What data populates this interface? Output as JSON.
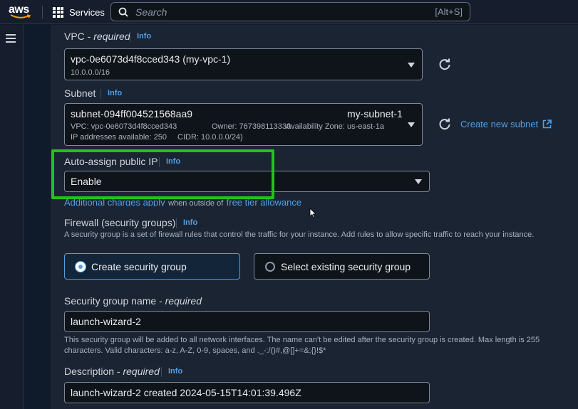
{
  "topbar": {
    "logo": "aws",
    "services_label": "Services",
    "search_placeholder": "Search",
    "search_shortcut": "[Alt+S]"
  },
  "vpc": {
    "label": "VPC",
    "required": "required",
    "info": "Info",
    "value": "vpc-0e6073d4f8cced343 (my-vpc-1)",
    "cidr": "10.0.0.0/16"
  },
  "subnet": {
    "label": "Subnet",
    "info": "Info",
    "value": "subnet-094ff004521568aa9",
    "name": "my-subnet-1",
    "detail_vpc": "VPC: vpc-0e6073d4f8cced343",
    "detail_owner": "Owner: 767398113330",
    "detail_az": "Availability Zone: us-east-1a",
    "detail_ips": "IP addresses available: 250",
    "detail_cidr": "CIDR: 10.0.0.0/24)",
    "create_link": "Create new subnet"
  },
  "auto_assign": {
    "label": "Auto-assign public IP",
    "info": "Info",
    "value": "Enable",
    "note_prefix": "Additional charges apply",
    "note_mid": "when outside of",
    "note_link": "free tier allowance"
  },
  "firewall": {
    "label": "Firewall (security groups)",
    "info": "Info",
    "description": "A security group is a set of firewall rules that control the traffic for your instance. Add rules to allow specific traffic to reach your instance.",
    "option_create": "Create security group",
    "option_existing": "Select existing security group",
    "selected": "Create security group"
  },
  "sg_name": {
    "label": "Security group name",
    "required": "required",
    "value": "launch-wizard-2",
    "help": "This security group will be added to all network interfaces. The name can't be edited after the security group is created. Max length is 255 characters. Valid characters: a-z, A-Z, 0-9, spaces, and ._-:/()#,@[]+=&;{}!$*"
  },
  "description_field": {
    "label": "Description",
    "required": "required",
    "info": "Info",
    "value": "launch-wizard-2 created 2024-05-15T14:01:39.496Z"
  },
  "colors": {
    "accent": "#539fe5",
    "highlight": "#23c21a",
    "panel": "#1b2433"
  }
}
